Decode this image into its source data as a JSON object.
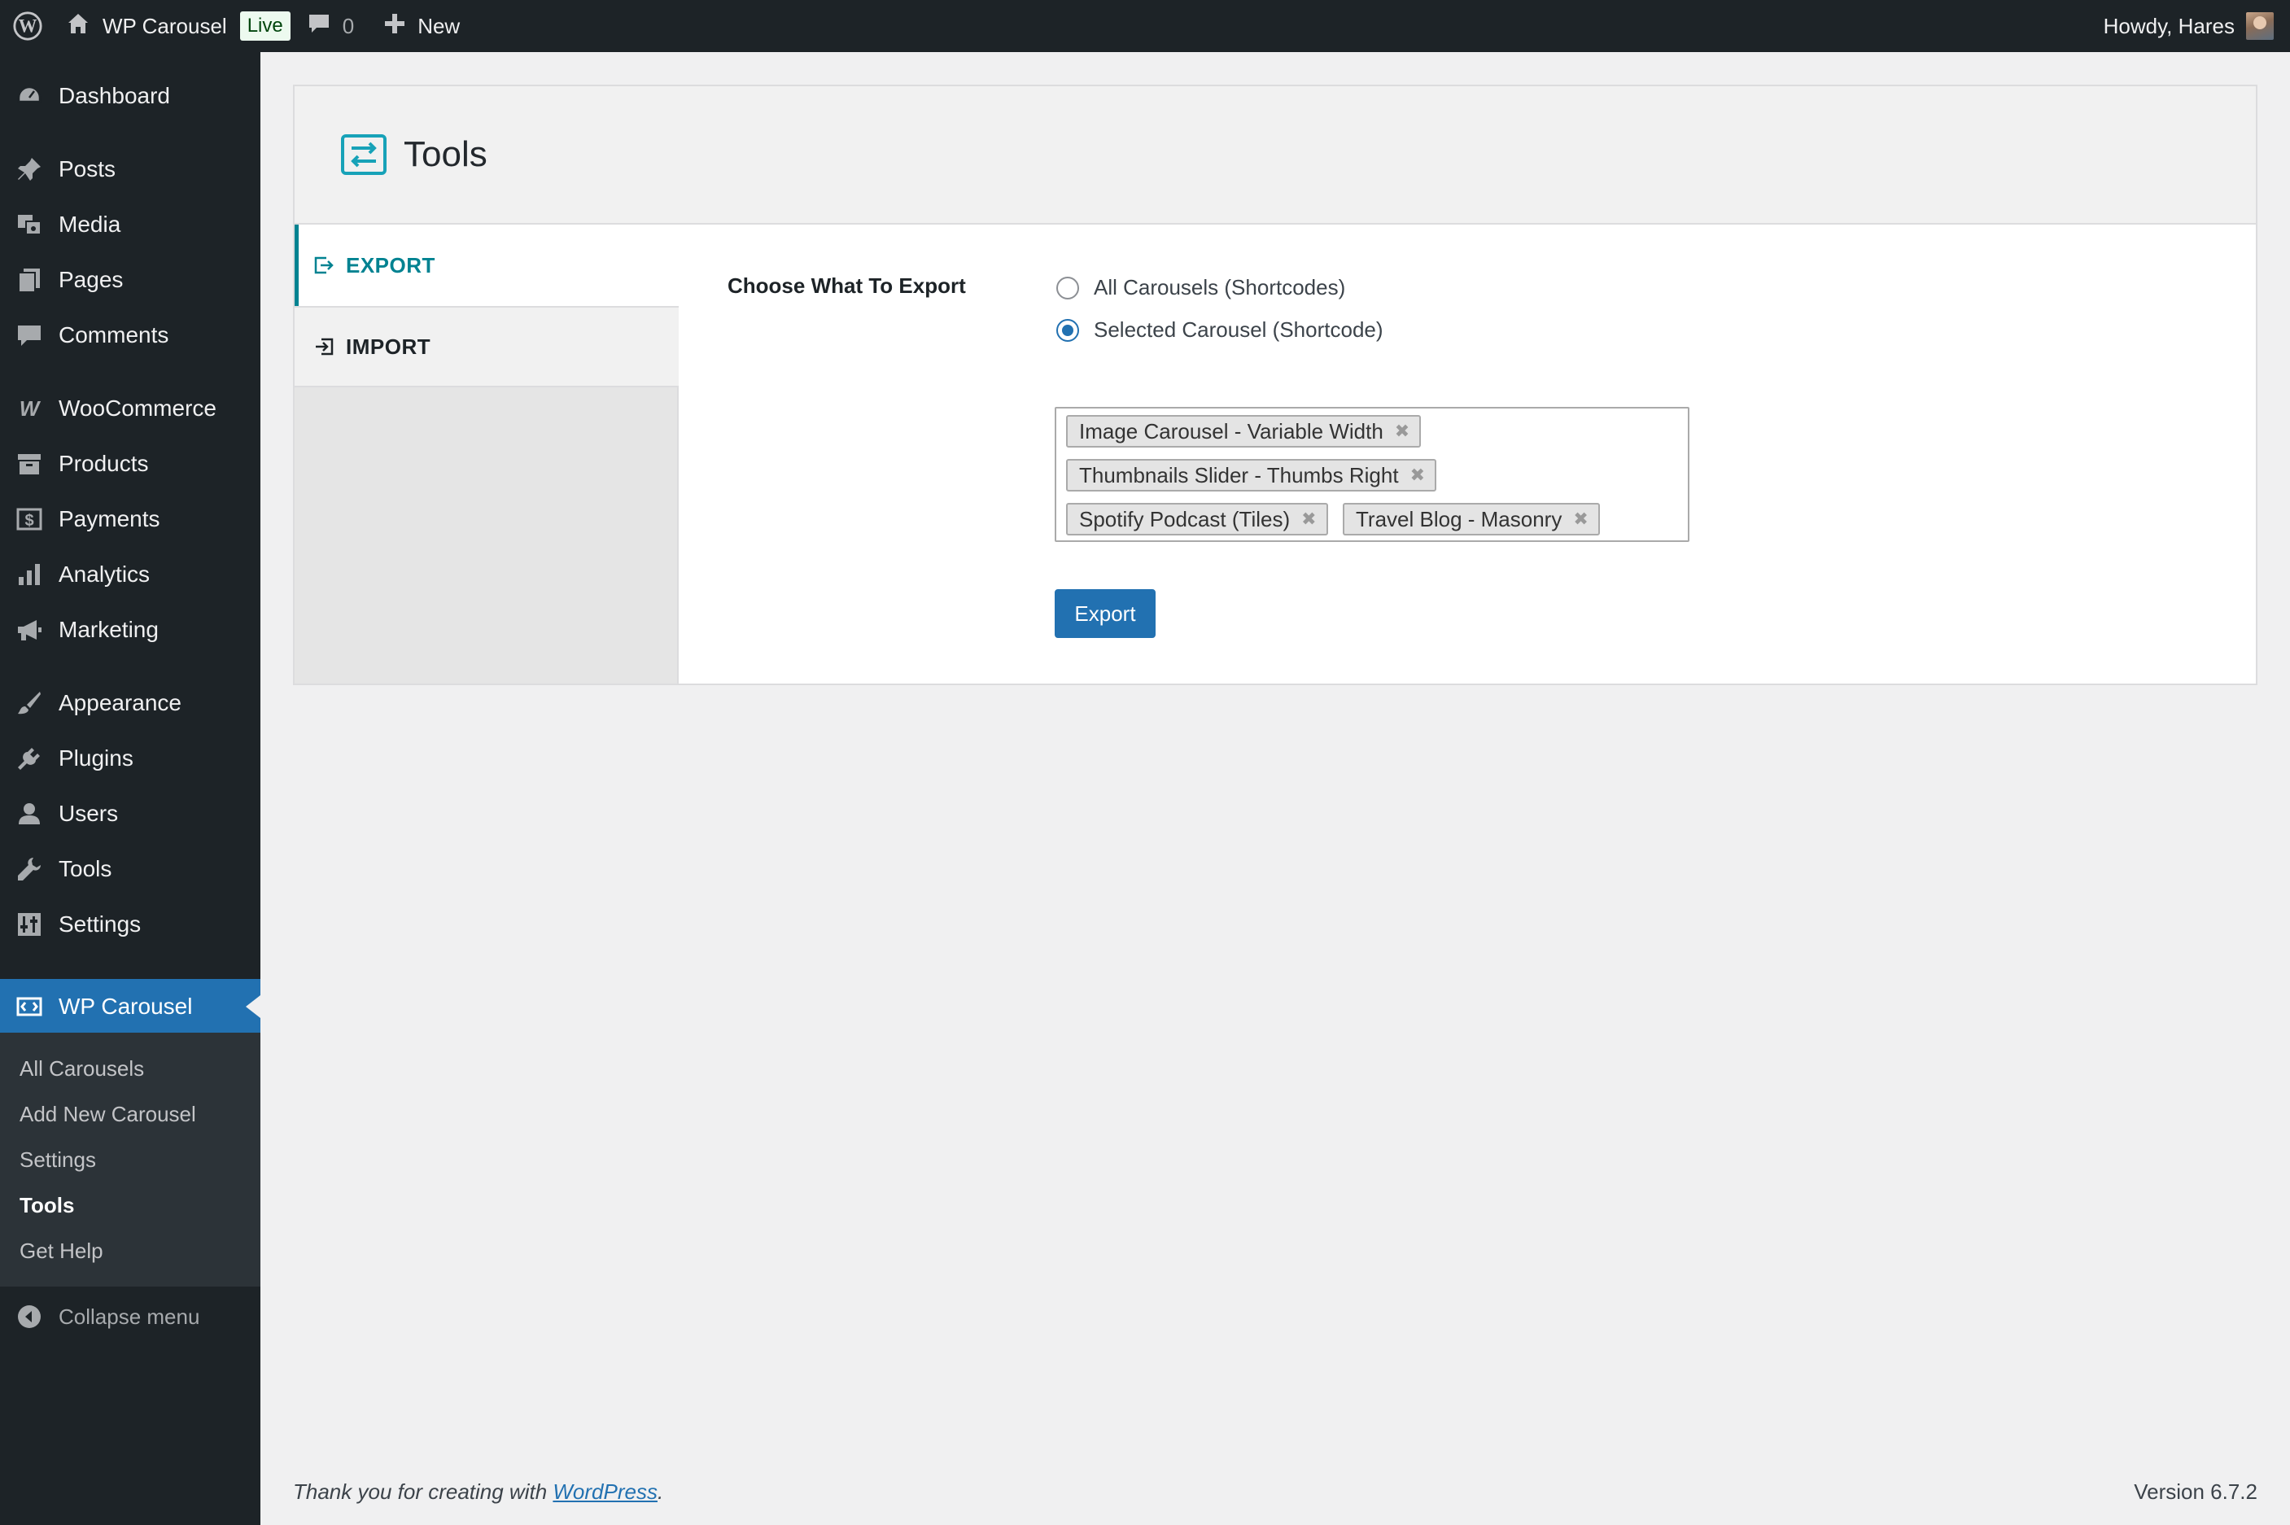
{
  "adminbar": {
    "site_name": "WP Carousel",
    "live_badge": "Live",
    "comments_count": "0",
    "new_label": "New",
    "howdy": "Howdy, Hares"
  },
  "sidebar": {
    "items": [
      {
        "label": "Dashboard",
        "icon": "dashboard-icon"
      },
      {
        "label": "Posts",
        "icon": "pin-icon"
      },
      {
        "label": "Media",
        "icon": "media-icon"
      },
      {
        "label": "Pages",
        "icon": "pages-icon"
      },
      {
        "label": "Comments",
        "icon": "comment-icon"
      },
      {
        "label": "WooCommerce",
        "icon": "woocommerce-icon"
      },
      {
        "label": "Products",
        "icon": "archive-icon"
      },
      {
        "label": "Payments",
        "icon": "dollar-icon"
      },
      {
        "label": "Analytics",
        "icon": "bar-chart-icon"
      },
      {
        "label": "Marketing",
        "icon": "megaphone-icon"
      },
      {
        "label": "Appearance",
        "icon": "brush-icon"
      },
      {
        "label": "Plugins",
        "icon": "plug-icon"
      },
      {
        "label": "Users",
        "icon": "user-icon"
      },
      {
        "label": "Tools",
        "icon": "wrench-icon"
      },
      {
        "label": "Settings",
        "icon": "sliders-icon"
      },
      {
        "label": "WP Carousel",
        "icon": "carousel-icon"
      }
    ],
    "submenu": [
      "All Carousels",
      "Add New Carousel",
      "Settings",
      "Tools",
      "Get Help"
    ],
    "collapse_label": "Collapse menu"
  },
  "page": {
    "title": "Tools",
    "tabs": {
      "export": "EXPORT",
      "import": "IMPORT"
    },
    "export": {
      "field_label": "Choose What To Export",
      "option_all": "All Carousels (Shortcodes)",
      "option_selected": "Selected Carousel (Shortcode)",
      "selected_option": "option_selected",
      "chips": [
        "Image Carousel - Variable Width",
        "Thumbnails Slider - Thumbs Right",
        "Spotify Podcast (Tiles)",
        "Travel Blog - Masonry"
      ],
      "button_label": "Export"
    }
  },
  "footer": {
    "thanks_prefix": "Thank you for creating with ",
    "thanks_link": "WordPress",
    "thanks_suffix": ".",
    "version": "Version 6.7.2"
  },
  "colors": {
    "admin_dark": "#1d2327",
    "accent_blue": "#2271b1",
    "teal": "#008291"
  }
}
